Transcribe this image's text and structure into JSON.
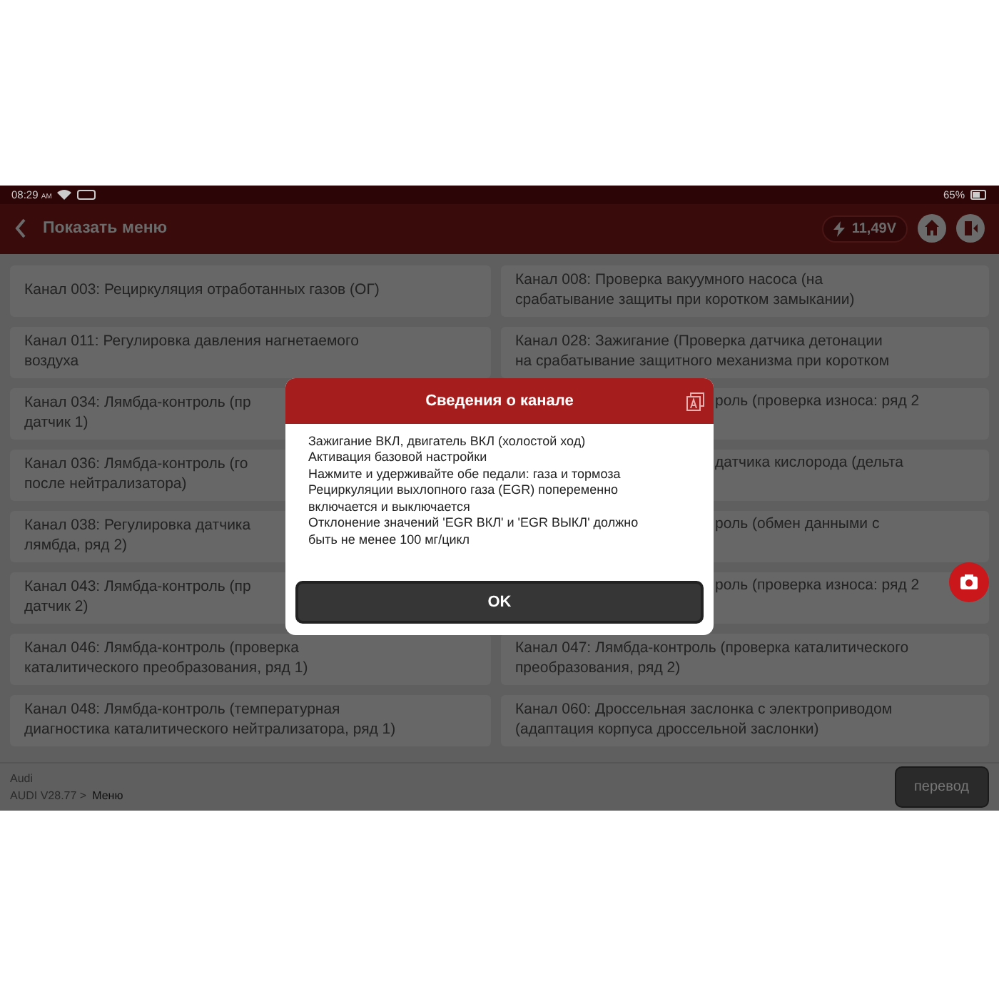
{
  "status_bar": {
    "time": "08:29",
    "time_suffix": "AM",
    "battery": "65%"
  },
  "header": {
    "title": "Показать меню",
    "voltage": "11,49V"
  },
  "channels": [
    {
      "lines": [
        "Канал 003: Рециркуляция отработанных газов (ОГ)"
      ]
    },
    {
      "lines": [
        "Канал 008: Проверка вакуумного насоса (на",
        "срабатывание защиты при коротком замыкании)"
      ]
    },
    {
      "lines": [
        "Канал 011: Регулировка давления нагнетаемого",
        "воздуха"
      ]
    },
    {
      "lines": [
        "Канал 028: Зажигание (Проверка датчика детонации",
        "на срабатывание защитного механизма при коротком"
      ]
    },
    {
      "lines": [
        "Канал 034: Лямбда-контроль (пр",
        "датчик 1)"
      ]
    },
    {
      "lines": [
        "роль (проверка износа: ряд 2"
      ],
      "kind": "covered"
    },
    {
      "lines": [
        "Канал 036: Лямбда-контроль (го",
        "после нейтрализатора)"
      ]
    },
    {
      "lines": [
        "датчика кислорода (дельта"
      ],
      "kind": "covered"
    },
    {
      "lines": [
        "Канал 038: Регулировка датчика",
        "лямбда, ряд 2)"
      ]
    },
    {
      "lines": [
        "роль (обмен данными с"
      ],
      "kind": "covered"
    },
    {
      "lines": [
        "Канал 043: Лямбда-контроль (пр",
        "датчик 2)"
      ]
    },
    {
      "lines": [
        "роль (проверка износа: ряд 2"
      ],
      "kind": "covered"
    },
    {
      "lines": [
        "Канал 046: Лямбда-контроль (проверка",
        "каталитического преобразования, ряд 1)"
      ]
    },
    {
      "lines": [
        "Канал 047: Лямбда-контроль (проверка каталитического",
        "преобразования, ряд 2)"
      ]
    },
    {
      "lines": [
        "Канал 048: Лямбда-контроль (температурная",
        "диагностика каталитического нейтрализатора, ряд 1)"
      ]
    },
    {
      "lines": [
        "Канал 060: Дроссельная заслонка с электроприводом",
        "(адаптация корпуса дроссельной заслонки)"
      ]
    }
  ],
  "footer": {
    "make": "Audi",
    "path": "AUDI V28.77 >",
    "current": "Меню",
    "button": "перевод"
  },
  "dialog": {
    "title": "Сведения о канале",
    "lines": [
      "Зажигание ВКЛ, двигатель ВКЛ (холостой ход)",
      "Активация базовой настройки",
      "Нажмите и удерживайте обе педали: газа и тормоза",
      "Рециркуляции выхлопного газа (EGR) попеременно",
      "включается и выключается",
      "Отклонение значений 'EGR ВКЛ' и 'EGR ВЫКЛ' должно",
      "быть не менее 100 мг/цикл"
    ],
    "button": "OK"
  }
}
